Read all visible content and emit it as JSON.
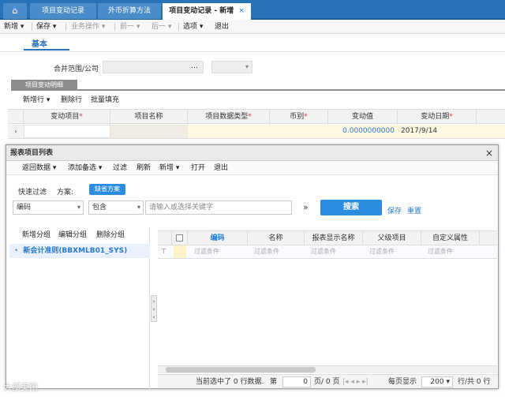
{
  "tabs": {
    "home_icon": "home-icon",
    "items": [
      "项目变动记录",
      "外币折算方法",
      "项目变动记录 - 新增"
    ],
    "close": "×"
  },
  "toolbar": {
    "new": "新增 ▾",
    "save": "保存 ▾",
    "business": "业务操作 ▾",
    "prev": "前一 ▾",
    "next": "后一 ▾",
    "options": "选项 ▾",
    "exit": "退出"
  },
  "subtab": "基本",
  "form": {
    "scope_label": "合并范围/公司",
    "ellipsis": "…"
  },
  "section": {
    "title": "项目变动明细",
    "add_row": "新增行 ▾",
    "delete_row": "删除行",
    "batch_fill": "批量填充"
  },
  "grid": {
    "headers": [
      "变动项目",
      "项目名称",
      "项目数据类型",
      "币别",
      "变动值",
      "变动日期"
    ],
    "required": [
      "*",
      "",
      "*",
      "*",
      "",
      "*"
    ],
    "row": {
      "value": "0.0000000000",
      "date": "2017/9/14"
    }
  },
  "dialog": {
    "title": "报表项目列表",
    "close": "×",
    "toolbar": [
      "返回数据 ▾",
      "添加备选 ▾",
      "过滤",
      "刷新",
      "新增 ▾",
      "打开",
      "退出"
    ],
    "quick_filter": "快速过滤",
    "scheme": "方案:",
    "default_scheme": "缺省方案",
    "field_value": "编码",
    "op_value": "包含",
    "keyword_placeholder": "请输入或选择关键字",
    "search": "搜索",
    "save": "保存",
    "reset": "重置",
    "expand": "»",
    "group_actions": [
      "新增分组",
      "编辑分组",
      "删除分组"
    ],
    "tree_item": "新会计准则(BBXMLB01_SYS)",
    "columns": [
      "编码",
      "名称",
      "报表显示名称",
      "父级项目",
      "自定义属性"
    ],
    "filter_text": "过滤条件",
    "footer": {
      "selected": "当前选中了 0 行数据.",
      "page_label": "第",
      "page_value": "0",
      "page_total": "页/ 0 页",
      "per_page": "每页显示",
      "per_page_value": "200",
      "rows_total": "行/共 0 行"
    }
  },
  "watermark": "大部美阳"
}
